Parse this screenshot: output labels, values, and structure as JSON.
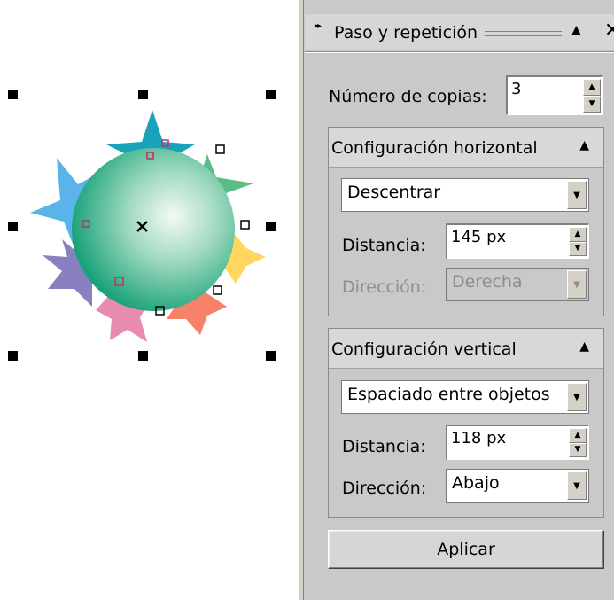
{
  "panel": {
    "title": "Paso y repetición",
    "title_collapse_icon": "triangle-up-icon",
    "close_icon": "close-icon",
    "copies_label": "Número de copias:",
    "copies_value": "3",
    "horizontal": {
      "header": "Configuración horizontal",
      "mode_value": "Descentrar",
      "distance_label": "Distancia:",
      "distance_value": "145 px",
      "direction_label": "Dirección:",
      "direction_value": "Derecha",
      "direction_disabled": true
    },
    "vertical": {
      "header": "Configuración vertical",
      "mode_value": "Espaciado entre objetos",
      "distance_label": "Distancia:",
      "distance_value": "118 px",
      "direction_label": "Dirección:",
      "direction_value": "Abajo"
    },
    "apply_label": "Aplicar"
  },
  "canvas": {
    "object": "gradient-sphere-with-stars",
    "colors": {
      "sphere_center": "#f2f8f4",
      "sphere_edge": "#1aa37a",
      "star_teal": "#1aa3b8",
      "star_green": "#5cbd84",
      "star_blue": "#5ab4ea",
      "star_yellow": "#ffd75e",
      "star_purple": "#8a80bf",
      "star_pink": "#e88bb0",
      "star_orange": "#f7826a"
    }
  }
}
